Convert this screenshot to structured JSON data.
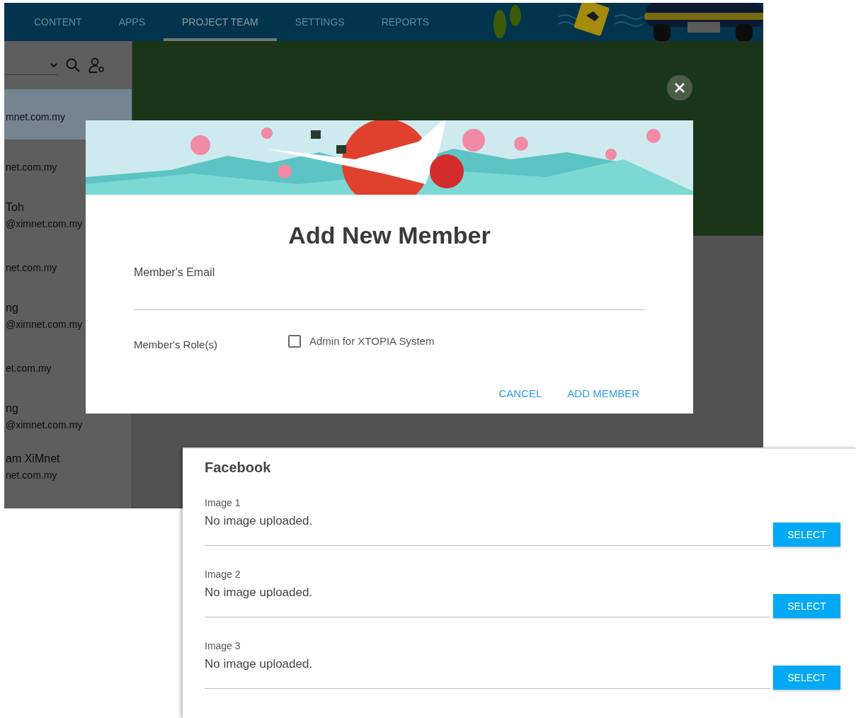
{
  "app": {
    "nav": {
      "tabs": [
        {
          "label": "CONTENT",
          "selected": false
        },
        {
          "label": "APPS",
          "selected": false
        },
        {
          "label": "PROJECT TEAM",
          "selected": true
        },
        {
          "label": "SETTINGS",
          "selected": false
        },
        {
          "label": "REPORTS",
          "selected": false
        }
      ]
    },
    "sidebar": {
      "items": [
        {
          "email": "mnet.com.my",
          "selected": true
        },
        {
          "email": "net.com.my",
          "selected": false
        },
        {
          "name": "Toh",
          "email": "@ximnet.com.my",
          "selected": false
        },
        {
          "email": "net.com.my",
          "selected": false
        },
        {
          "name": "ng",
          "email": "@ximnet.com.my",
          "selected": false
        },
        {
          "email": "et.com.my",
          "selected": false
        },
        {
          "name": "ng",
          "email": "@ximnet.com.my",
          "selected": false
        },
        {
          "name": "am XiMnet",
          "email": "net.com.my",
          "selected": false
        }
      ]
    },
    "dialog": {
      "title": "Add New Member",
      "email_label": "Member's Email",
      "role_label": "Member's Role(s)",
      "roles": [
        {
          "label": "Admin for XTOPIA System",
          "checked": false
        }
      ],
      "buttons": [
        {
          "label": "CANCEL"
        },
        {
          "label": "ADD MEMBER"
        }
      ]
    }
  },
  "facebook_panel": {
    "title": "Facebook",
    "images": [
      {
        "label": "Image 1",
        "value": "No image uploaded.",
        "button": "SELECT"
      },
      {
        "label": "Image 2",
        "value": "No image uploaded.",
        "button": "SELECT"
      },
      {
        "label": "Image 3",
        "value": "No image uploaded.",
        "button": "SELECT"
      }
    ]
  }
}
